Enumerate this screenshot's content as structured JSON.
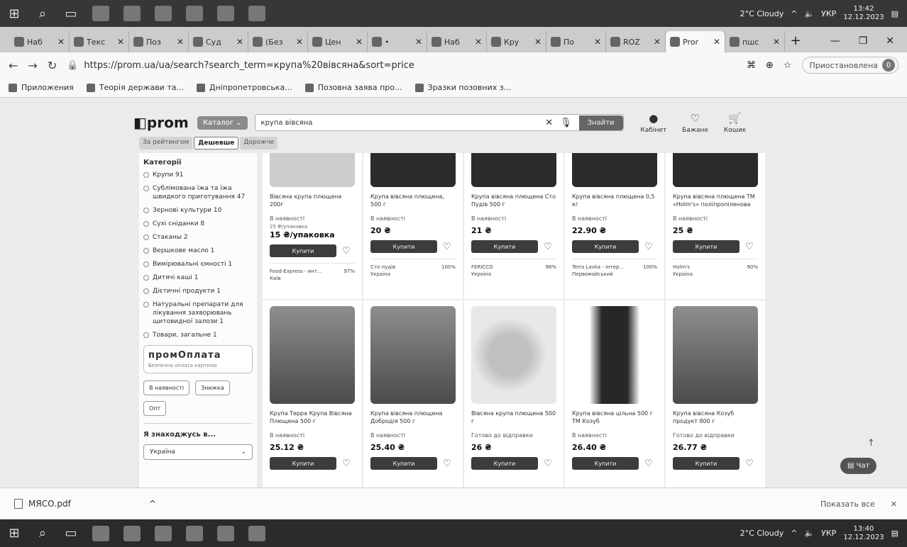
{
  "taskbar_top": {
    "weather": "2°C Cloudy",
    "lang": "УКР",
    "time": "13:42",
    "date": "12.12.2023"
  },
  "taskbar_bottom": {
    "weather": "2°C Cloudy",
    "lang": "УКР",
    "time": "13:40",
    "date": "12.12.2023"
  },
  "tabs": [
    {
      "label": "Наб"
    },
    {
      "label": "Текс"
    },
    {
      "label": "Поз"
    },
    {
      "label": "Суд"
    },
    {
      "label": "(Без"
    },
    {
      "label": "Цен"
    },
    {
      "label": "•"
    },
    {
      "label": "Наб"
    },
    {
      "label": "Кру"
    },
    {
      "label": "По"
    },
    {
      "label": "ROZ"
    },
    {
      "label": "Pror",
      "active": true
    },
    {
      "label": "пшс"
    }
  ],
  "address": {
    "url": "https://prom.ua/ua/search?search_term=крупа%20вівсяна&sort=price",
    "paused": "Приостановлена"
  },
  "bookmarks": [
    "Приложения",
    "Теорія держави та...",
    "Дніпропетровська...",
    "Позовна заява про...",
    "Зразки позовних з..."
  ],
  "site": {
    "logo": "prom",
    "catalog": "Каталог",
    "search_value": "крупа вівсяна",
    "search_btn": "Знайти",
    "header_icons": [
      "Кабінет",
      "Бажане",
      "Кошик"
    ]
  },
  "sort_tabs": [
    "За рейтингом",
    "Дешевше",
    "Дорожче"
  ],
  "sidebar": {
    "title": "Категорії",
    "categories": [
      "Крупи 91",
      "Сублімована їжа та їжа швидкого приготування 47",
      "Зернові культури 10",
      "Сухі сніданки 8",
      "Стаканы 2",
      "Вершкове масло 1",
      "Вимірювальні ємності 1",
      "Дитячі каші 1",
      "Дієтичні продукти 1",
      "Натуральні препарати для лікування захворювань щитовидної залози 1",
      "Товари, загальне 1"
    ],
    "promo_title": "промОплата",
    "promo_sub": "Безпечна оплата карткою",
    "filters": [
      "В наявності",
      "Знижка",
      "Опт"
    ],
    "location_title": "Я знаходжусь в...",
    "location_value": "Україна"
  },
  "products_row1": [
    {
      "name": "Вівсяна крупа плющена 200г",
      "avail": "В наявності",
      "old": "25 ₴/упаковка",
      "price": "15 ₴/упаковка",
      "seller": "Food-Express - инт...",
      "city": "Київ",
      "rating": "97%"
    },
    {
      "name": "Крупа вівсяна плющена, 500 г",
      "avail": "В наявності",
      "old": "",
      "price": "20 ₴",
      "seller": "Сто пудів",
      "city": "Україна",
      "rating": "100%"
    },
    {
      "name": "Крупа вівсяна плющена Сто Пудів 500 г",
      "avail": "В наявності",
      "old": "",
      "price": "21 ₴",
      "seller": "FERICCO",
      "city": "Україна",
      "rating": "98%"
    },
    {
      "name": "Крупа вівсяна плющена 0,5 кг",
      "avail": "В наявності",
      "old": "",
      "price": "22.90 ₴",
      "seller": "Terra Lavka - інтер...",
      "city": "Первомайський",
      "rating": "100%"
    },
    {
      "name": "Крупа вівсяна плющена ТМ «Holm's» поліпропіленова",
      "avail": "В наявності",
      "old": "",
      "price": "25 ₴",
      "seller": "Holm's",
      "city": "Україна",
      "rating": "90%"
    }
  ],
  "products_row2": [
    {
      "name": "Крупа Терра Крупа Вівсяна Плющена 500 г",
      "avail": "В наявності",
      "price": "25.12 ₴"
    },
    {
      "name": "Крупа вівсяна плющена Добродія 500 г",
      "avail": "В наявності",
      "price": "25.40 ₴"
    },
    {
      "name": "Вівсяна крупа плющена 500 г",
      "avail": "Готово до відправки",
      "price": "26 ₴"
    },
    {
      "name": "Крупа вівсяна цільна 500 г ТМ Козуб",
      "avail": "В наявності",
      "price": "26.40 ₴"
    },
    {
      "name": "Крупа вівсяна Козуб продукт 800 г",
      "avail": "Готово до відправки",
      "price": "26.77 ₴"
    }
  ],
  "buy_label": "Купити",
  "chat_label": "Чат",
  "downloads": {
    "file": "МЯСО.pdf",
    "show_all": "Показать все"
  }
}
